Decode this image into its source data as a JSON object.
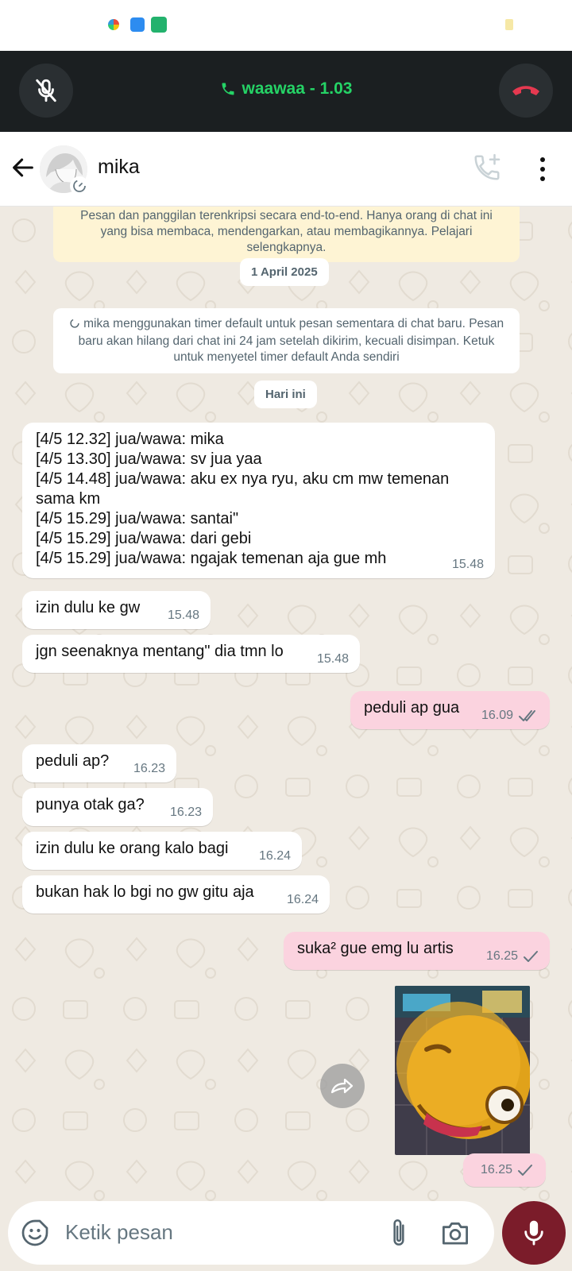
{
  "call": {
    "title": "waawaa - 1.03"
  },
  "contact": {
    "name": "mika"
  },
  "encryption_notice": "Pesan dan panggilan terenkripsi secara end-to-end. Hanya orang di chat ini yang bisa membaca, mendengarkan, atau membagikannya. Pelajari selengkapnya.",
  "dates": {
    "first": "1 April 2025",
    "today": "Hari ini"
  },
  "timer_notice": "mika menggunakan timer default untuk pesan sementara di chat baru. Pesan baru akan hilang dari chat ini 24 jam setelah dikirim, kecuali disimpan. Ketuk untuk menyetel timer default Anda sendiri",
  "messages": [
    {
      "dir": "in",
      "text": "[4/5 12.32] jua/wawa: mika\n[4/5 13.30] jua/wawa: sv jua yaa\n[4/5 14.48] jua/wawa: aku ex nya ryu, aku cm mw temenan sama km\n[4/5 15.29] jua/wawa: santai\"\n[4/5 15.29] jua/wawa: dari gebi\n[4/5 15.29] jua/wawa: ngajak temenan aja gue mh",
      "time": "15.48"
    },
    {
      "dir": "in",
      "text": "izin dulu ke gw",
      "time": "15.48"
    },
    {
      "dir": "in",
      "text": "jgn seenaknya mentang\" dia tmn lo",
      "time": "15.48"
    },
    {
      "dir": "out",
      "text": "peduli ap gua",
      "time": "16.09",
      "status": "read"
    },
    {
      "dir": "in",
      "text": "peduli ap?",
      "time": "16.23"
    },
    {
      "dir": "in",
      "text": "punya otak ga?",
      "time": "16.23"
    },
    {
      "dir": "in",
      "text": "izin dulu ke orang kalo bagi",
      "time": "16.24"
    },
    {
      "dir": "in",
      "text": "bukan hak lo bgi no gw gitu aja",
      "time": "16.24"
    },
    {
      "dir": "out",
      "text": "suka² gue emg lu artis",
      "time": "16.25",
      "status": "sent"
    },
    {
      "dir": "out",
      "type": "image",
      "time": "16.25",
      "status": "sent"
    }
  ],
  "composer": {
    "placeholder": "Ketik pesan"
  },
  "colors": {
    "accent": "#25d366",
    "out_bubble": "#fbd3df",
    "end_call": "#e53950",
    "mic": "#7b1c2a"
  },
  "icons": [
    "mute-mic-icon",
    "phone-icon",
    "end-call-icon",
    "back-arrow-icon",
    "add-call-icon",
    "more-options-icon",
    "forward-icon",
    "emoji-icon",
    "attach-icon",
    "camera-icon",
    "mic-icon"
  ]
}
